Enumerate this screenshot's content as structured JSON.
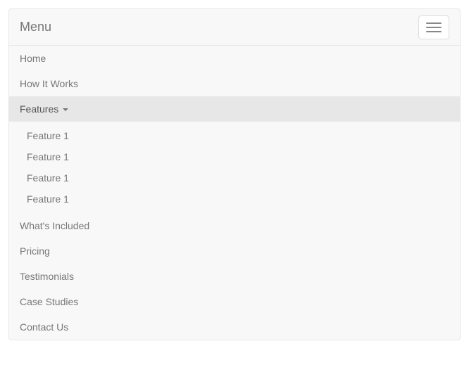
{
  "navbar": {
    "brand": "Menu",
    "items": [
      {
        "label": "Home"
      },
      {
        "label": "How It Works"
      },
      {
        "label": "Features",
        "dropdown": [
          "Feature 1",
          "Feature 1",
          "Feature 1",
          "Feature 1"
        ]
      },
      {
        "label": "What's Included"
      },
      {
        "label": "Pricing"
      },
      {
        "label": "Testimonials"
      },
      {
        "label": "Case Studies"
      },
      {
        "label": "Contact Us"
      }
    ]
  }
}
